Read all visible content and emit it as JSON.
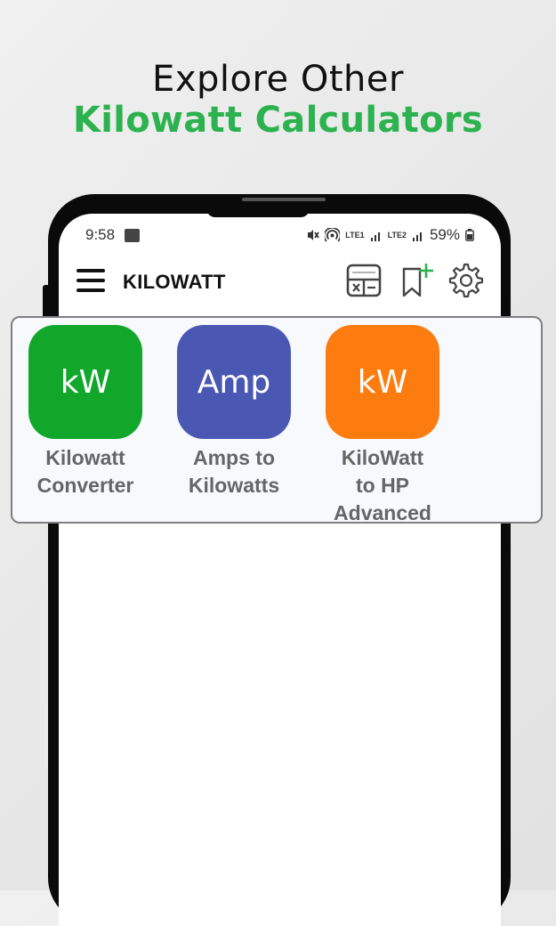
{
  "headline": {
    "line1": "Explore Other",
    "line2": "Kilowatt Calculators"
  },
  "status_bar": {
    "time": "9:58",
    "lte1": "LTE1",
    "lte2": "LTE2",
    "battery": "59%"
  },
  "toolbar": {
    "title": "KILOWATT",
    "icons": [
      "calculator-icon",
      "bookmark-add-icon",
      "settings-gear-icon"
    ]
  },
  "apps": [
    {
      "tile_text": "kW",
      "label_lines": [
        "Kilowatt",
        "Converter"
      ],
      "color": "#11a72b"
    },
    {
      "tile_text": "Amp",
      "label_lines": [
        "Amps to",
        "Kilowatts"
      ],
      "color": "#4a58b4"
    },
    {
      "tile_text": "kW",
      "label_lines": [
        "KiloWatt",
        "to HP",
        "Advanced"
      ],
      "color": "#fd7c0f"
    }
  ],
  "colors": {
    "accent_green": "#2cb34f"
  }
}
